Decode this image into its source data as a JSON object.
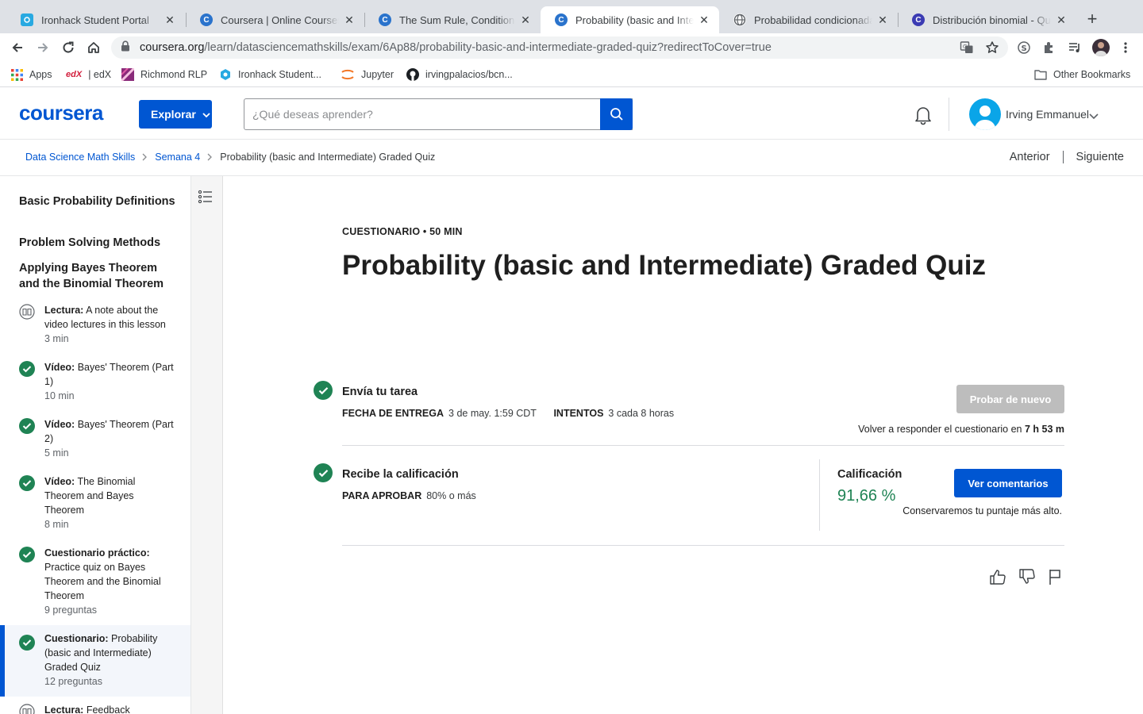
{
  "browser": {
    "tabs": [
      {
        "title": "Ironhack Student Portal",
        "favicon": "ironhack-icon",
        "favicon_color": "#28a9e1"
      },
      {
        "title": "Coursera | Online Courses & Credentials",
        "favicon": "coursera-icon",
        "favicon_color": "#2a73cc"
      },
      {
        "title": "The Sum Rule, Conditional Probability",
        "favicon": "coursera-icon",
        "favicon_color": "#2a73cc"
      },
      {
        "title": "Probability (basic and Intermediate) Graded Quiz",
        "favicon": "coursera-icon",
        "favicon_color": "#2a73cc"
      },
      {
        "title": "Probabilidad condicionada",
        "favicon": "globe-icon",
        "favicon_color": "#5f6368"
      },
      {
        "title": "Distribución binomial - Qué es",
        "favicon": "c-icon",
        "favicon_color": "#3b3bb3"
      }
    ],
    "active_tab": 3,
    "url_host": "coursera.org",
    "url_path": "/learn/datasciencemathskills/exam/6Ap88/probability-basic-and-intermediate-graded-quiz?redirectToCover=true",
    "bookmarks": [
      {
        "label": "Apps",
        "icon": "apps-grid-icon"
      },
      {
        "label": "| edX",
        "icon": "edx-icon"
      },
      {
        "label": "Richmond RLP",
        "icon": "richmond-icon"
      },
      {
        "label": "Ironhack Student...",
        "icon": "ironhack-icon"
      },
      {
        "label": "Jupyter",
        "icon": "jupyter-icon"
      },
      {
        "label": "irvingpalacios/bcn...",
        "icon": "github-icon"
      }
    ],
    "other_bookmarks": "Other Bookmarks"
  },
  "header": {
    "logo": "coursera",
    "explore_label": "Explorar",
    "search_placeholder": "¿Qué deseas aprender?",
    "user_name": "Irving Emmanuel",
    "brand_color": "#0056d2"
  },
  "breadcrumb": {
    "items": [
      "Data Science Math Skills",
      "Semana 4",
      "Probability (basic and Intermediate) Graded Quiz"
    ],
    "prev_label": "Anterior",
    "next_label": "Siguiente"
  },
  "sidebar": {
    "sections": [
      "Basic Probability Definitions",
      "Problem Solving Methods",
      "Applying Bayes Theorem and the Binomial Theorem"
    ],
    "items": [
      {
        "type": "Lectura:",
        "title": "A note about the video lectures in this lesson",
        "meta": "3 min",
        "icon": "book-icon",
        "done": false
      },
      {
        "type": "Vídeo:",
        "title": "Bayes' Theorem (Part 1)",
        "meta": "10 min",
        "icon": "check-circle-icon",
        "done": true
      },
      {
        "type": "Vídeo:",
        "title": "Bayes' Theorem (Part 2)",
        "meta": "5 min",
        "icon": "check-circle-icon",
        "done": true
      },
      {
        "type": "Vídeo:",
        "title": "The Binomial Theorem and Bayes Theorem",
        "meta": "8 min",
        "icon": "check-circle-icon",
        "done": true
      },
      {
        "type": "Cuestionario práctico:",
        "title": "Practice quiz on Bayes Theorem and the Binomial Theorem",
        "meta": "9 preguntas",
        "icon": "check-circle-icon",
        "done": true
      },
      {
        "type": "Cuestionario:",
        "title": "Probability (basic and Intermediate) Graded Quiz",
        "meta": "12 preguntas",
        "icon": "check-circle-icon",
        "done": true,
        "active": true
      },
      {
        "type": "Lectura:",
        "title": "Feedback",
        "meta": "",
        "icon": "book-icon",
        "done": false
      }
    ]
  },
  "main": {
    "eyebrow": "CUESTIONARIO • 50 MIN",
    "title": "Probability (basic and Intermediate) Graded Quiz",
    "submit": {
      "title": "Envía tu tarea",
      "due_label": "FECHA DE ENTREGA",
      "due_value": "3 de may. 1:59 CDT",
      "attempts_label": "INTENTOS",
      "attempts_value": "3 cada 8 horas",
      "retry_button": "Probar de nuevo",
      "retry_text": "Volver a responder el cuestionario en",
      "retry_time": "7 h 53 m"
    },
    "grade": {
      "title": "Recibe la calificación",
      "pass_label": "PARA APROBAR",
      "pass_value": "80% o más",
      "grade_label": "Calificación",
      "grade_value": "91,66 %",
      "feedback_button": "Ver comentarios",
      "keep_text": "Conservaremos tu puntaje más alto."
    },
    "success_color": "#1f8354"
  }
}
